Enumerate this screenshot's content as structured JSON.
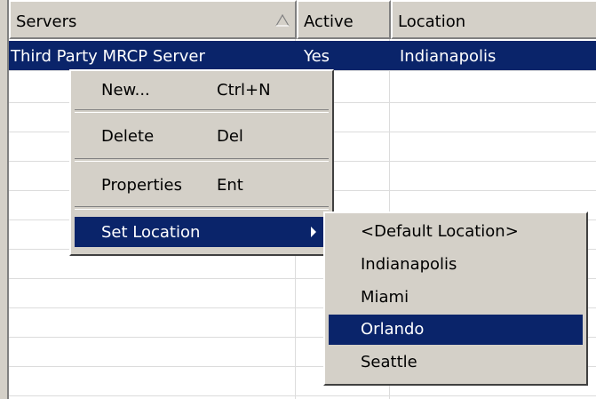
{
  "columns": {
    "servers": "Servers",
    "active": "Active",
    "location": "Location"
  },
  "row": {
    "server": "Third Party MRCP Server",
    "active": "Yes",
    "location": "Indianapolis"
  },
  "context_menu": {
    "new_label": "New...",
    "new_shortcut": "Ctrl+N",
    "delete_label": "Delete",
    "delete_shortcut": "Del",
    "properties_label": "Properties",
    "properties_shortcut": "Ent",
    "set_location_label": "Set Location"
  },
  "location_submenu": {
    "items": [
      "<Default Location>",
      "Indianapolis",
      "Miami",
      "Orlando",
      "Seattle"
    ],
    "highlighted": "Orlando"
  },
  "icons": {
    "sort": "sort-ascending-icon",
    "submenu": "submenu-arrow-icon"
  },
  "colors": {
    "selection": "#0a246a",
    "face": "#d4d0c8",
    "gridline": "#dcdcdc"
  }
}
